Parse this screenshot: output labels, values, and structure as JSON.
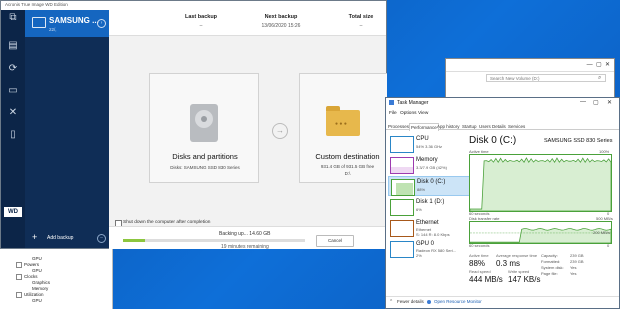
{
  "acronis": {
    "title": "Acronis True Image WD Edition",
    "device_name": "SAMSUNG ...",
    "device_sub": "22/,",
    "add_backup": "Add backup",
    "brand": "WD",
    "stats": [
      {
        "label": "Last backup",
        "value": "–"
      },
      {
        "label": "Next backup",
        "value": "13/06/2020 15:26"
      },
      {
        "label": "Total size",
        "value": "–"
      }
    ],
    "source": {
      "title": "Disks and partitions",
      "sub": "Disks: SAMSUNG SSD 830 Series"
    },
    "destination": {
      "title": "Custom destination",
      "sub1": "931.4 GB of 931.5 GB free",
      "sub2": "D:\\"
    },
    "shutdown_label": "Shut down the computer after completion",
    "progress_text": "Backing up... 14.60 GB",
    "progress_value": 0.12,
    "remaining": "19 minutes remaining",
    "cancel": "Cancel"
  },
  "explorer": {
    "search_placeholder": "Search New Volume (D:)"
  },
  "gpu_window": {
    "rows": [
      "GPU",
      "Powers",
      "GPU",
      "Clocks",
      "Graphics",
      "Memory",
      "Utilization",
      "GPU"
    ]
  },
  "taskman": {
    "title": "Task Manager",
    "menu": [
      "File",
      "Options",
      "View"
    ],
    "tabs": [
      "Processes",
      "Performance",
      "App history",
      "Startup",
      "Users",
      "Details",
      "Services"
    ],
    "items": [
      {
        "title": "CPU",
        "sub": "54% 3.36 GHz"
      },
      {
        "title": "Memory",
        "sub": "3.3/7.9 GB (42%)"
      },
      {
        "title": "Disk 0 (C:)",
        "sub": "88%"
      },
      {
        "title": "Disk 1 (D:)",
        "sub": "6%"
      },
      {
        "title": "Ethernet",
        "sub": "Ethernet",
        "sub2": "S: 144 R: 8.0 Kbps"
      },
      {
        "title": "GPU 0",
        "sub": "Radeon RX 580 Seri...",
        "sub2": "2%"
      }
    ],
    "disk_title": "Disk 0 (C:)",
    "disk_model": "SAMSUNG SSD 830 Series",
    "active_time_label": "Active time",
    "active_time_max": "100%",
    "seconds_label": "60 seconds",
    "zero": "0",
    "transfer_label": "Disk transfer rate",
    "transfer_max": "500 MB/s",
    "transfer_mid": "200 MB/s",
    "metrics": [
      {
        "label": "Active time",
        "value": "88%"
      },
      {
        "label": "Average response time",
        "value": "0.3 ms"
      },
      {
        "label": "Read speed",
        "value": "444 MB/s"
      },
      {
        "label": "Write speed",
        "value": "147 KB/s"
      }
    ],
    "props": [
      {
        "k": "Capacity:",
        "v": "239 GB"
      },
      {
        "k": "Formatted:",
        "v": "239 GB"
      },
      {
        "k": "System disk:",
        "v": "Yes"
      },
      {
        "k": "Page file:",
        "v": "Yes"
      }
    ],
    "fewer_details": "Fewer details",
    "open_monitor": "Open Resource Monitor"
  }
}
